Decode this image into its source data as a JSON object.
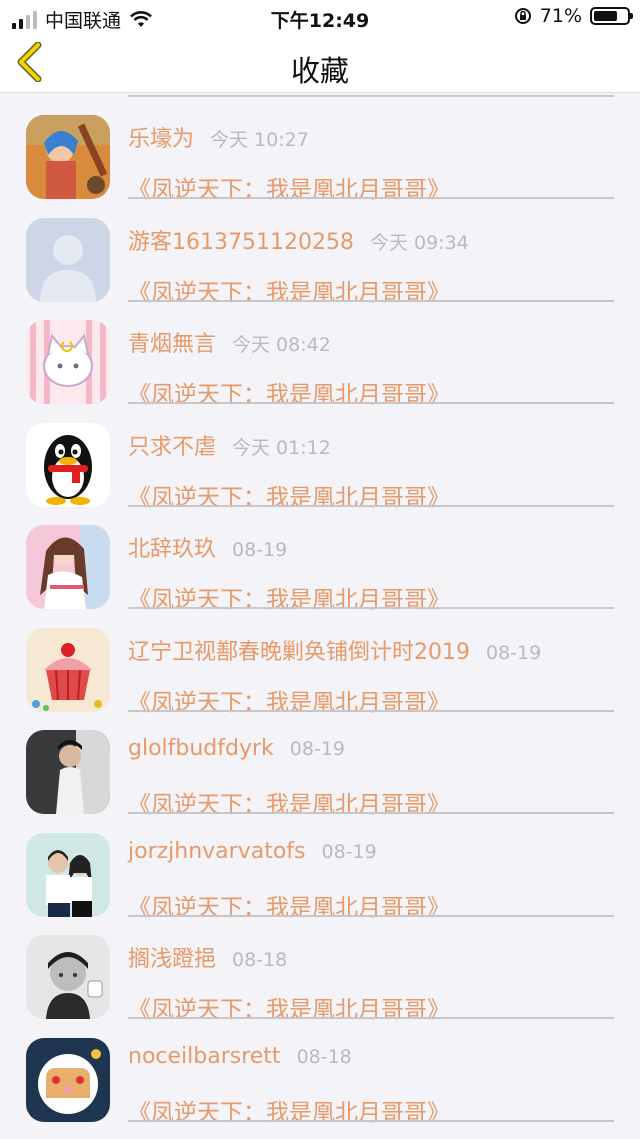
{
  "status": {
    "carrier": "中国联通",
    "time": "下午12:49",
    "battery": "71%",
    "battery_fraction": 0.71
  },
  "nav": {
    "title": "收藏"
  },
  "rows": [
    {
      "name": "乐壕为",
      "time": "今天 10:27",
      "content": "《凤逆天下：我是凰北月哥哥》",
      "avatar": "anime-fighter-avatar"
    },
    {
      "name": "游客1613751120258",
      "time": "今天 09:34",
      "content": "《凤逆天下：我是凰北月哥哥》",
      "avatar": "default-user-avatar"
    },
    {
      "name": "青烟無言",
      "time": "今天 08:42",
      "content": "《凤逆天下：我是凰北月哥哥》",
      "avatar": "cartoon-cat-avatar"
    },
    {
      "name": "只求不虐",
      "time": "今天 01:12",
      "content": "《凤逆天下：我是凰北月哥哥》",
      "avatar": "penguin-avatar"
    },
    {
      "name": "北辞玖玖",
      "time": "08-19",
      "content": "《凤逆天下：我是凰北月哥哥》",
      "avatar": "anime-girl-avatar"
    },
    {
      "name": "辽宁卫视鄯春晚剿奂铺倒计时2019",
      "time": "08-19",
      "content": "《凤逆天下：我是凰北月哥哥》",
      "avatar": "cupcake-avatar"
    },
    {
      "name": "glolfbudfdyrk",
      "time": "08-19",
      "content": "《凤逆天下：我是凰北月哥哥》",
      "avatar": "person-photo-avatar"
    },
    {
      "name": "jorzjhnvarvatofs",
      "time": "08-19",
      "content": "《凤逆天下：我是凰北月哥哥》",
      "avatar": "couple-photo-avatar"
    },
    {
      "name": "搁浅蹬挹",
      "time": "08-18",
      "content": "《凤逆天下：我是凰北月哥哥》",
      "avatar": "child-bw-avatar"
    },
    {
      "name": "noceilbarsrett",
      "time": "08-18",
      "content": "《凤逆天下：我是凰北月哥哥》",
      "avatar": "toast-avatar"
    }
  ]
}
